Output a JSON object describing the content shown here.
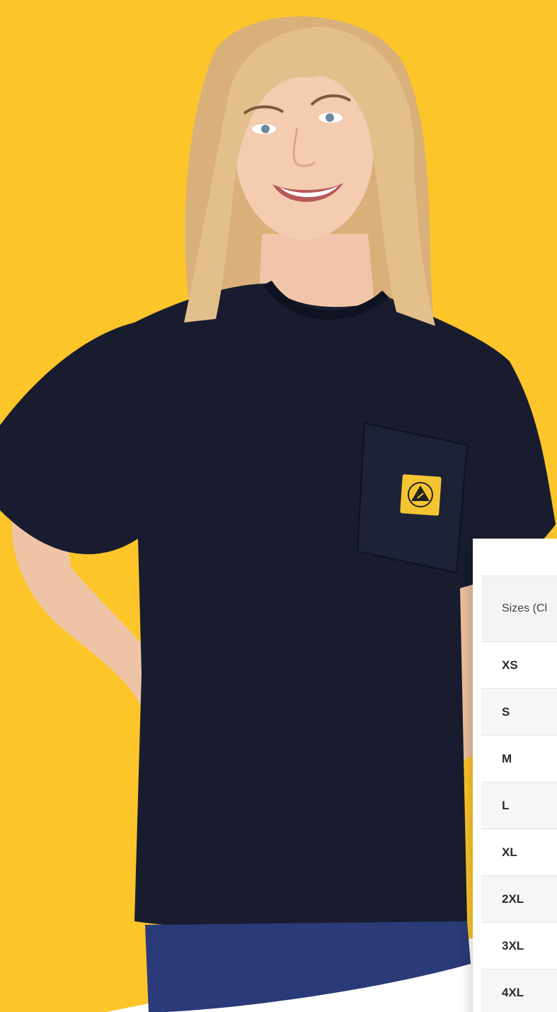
{
  "size_table": {
    "header": "Sizes (Cl",
    "rows": [
      "XS",
      "S",
      "M",
      "L",
      "XL",
      "2XL",
      "3XL",
      "4XL"
    ]
  },
  "colors": {
    "background": "#fcc52a",
    "shirt": "#181c2e",
    "esd_patch": "#f4c431"
  },
  "icons": [
    "esd-warning-icon"
  ]
}
